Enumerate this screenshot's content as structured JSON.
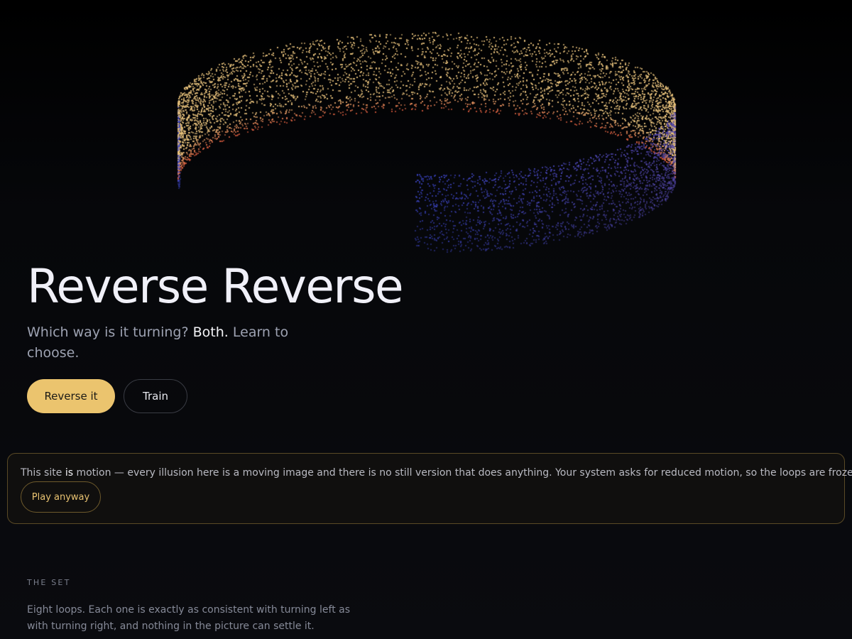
{
  "hero": {
    "title": "Reverse Reverse",
    "subtitle_lead": "Which way is it turning?",
    "subtitle_em": "Both.",
    "subtitle_tail": "Learn to choose."
  },
  "actions": {
    "primary_label": "Reverse it",
    "secondary_label": "Train"
  },
  "notice": {
    "text_lead": "This site",
    "text_em": "is",
    "text_tail": "motion — every illusion here is a moving image and there is no still version that does anything. Your system asks for reduced motion, so the loops are frozen.",
    "button_label": "Play anyway"
  },
  "set_section": {
    "label": "THE SET",
    "description": "Eight loops. Each one is exactly as consistent with turning left as with turning right, and nothing in the picture can settle it."
  },
  "colors": {
    "accent": "#ebc46e",
    "ring_warm": "#e8c27c",
    "ring_hot": "#d2553a",
    "ring_cool": "#3c46c8",
    "notice_border": "#5a4a26"
  }
}
